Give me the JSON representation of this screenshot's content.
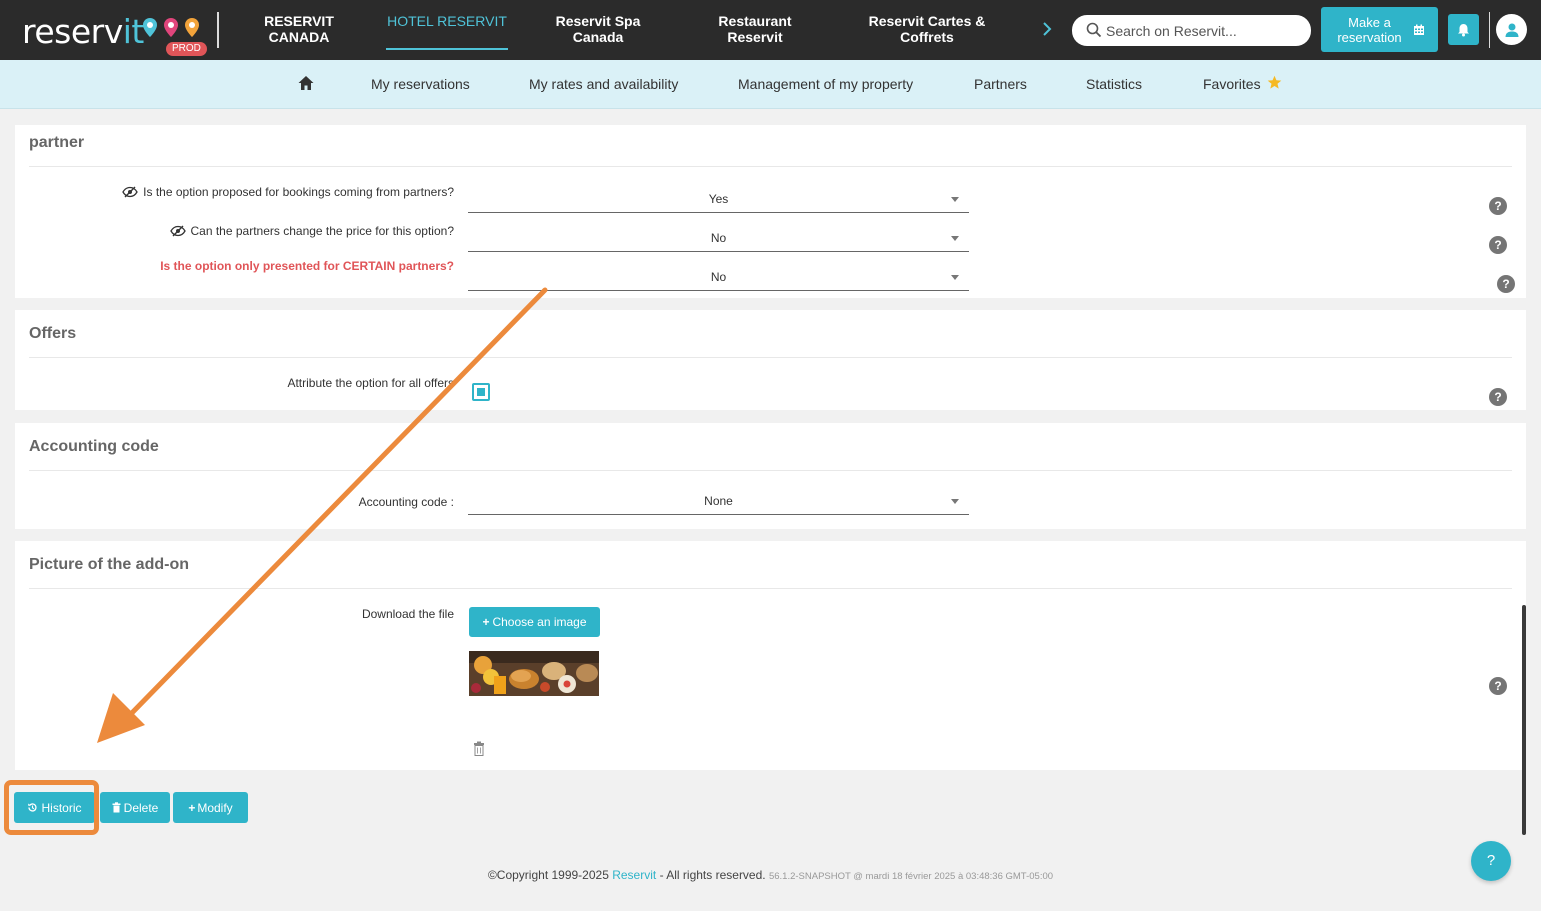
{
  "brand": {
    "logo_main": "reserv",
    "logo_accent": "it",
    "env_badge": "PROD"
  },
  "topnav": {
    "items": [
      {
        "label": "RESERVIT CANADA",
        "active": false
      },
      {
        "label": "HOTEL RESERVIT",
        "active": true
      },
      {
        "label": "Reservit Spa Canada",
        "active": false
      },
      {
        "label": "Restaurant Reservit",
        "active": false
      },
      {
        "label": "Reservit Cartes & Coffrets",
        "active": false
      }
    ],
    "more_icon": "chevron-right-icon",
    "search_placeholder": "Search on Reservit...",
    "make_reservation_label": "Make a reservation"
  },
  "subnav": {
    "home_icon": "home-icon",
    "items": [
      {
        "label": "My reservations"
      },
      {
        "label": "My rates and availability"
      },
      {
        "label": "Management of my property"
      },
      {
        "label": "Partners"
      },
      {
        "label": "Statistics"
      },
      {
        "label": "Favorites"
      }
    ]
  },
  "partner_section": {
    "title": "partner",
    "fields": [
      {
        "label": "Is the option proposed for bookings coming from partners?",
        "value": "Yes"
      },
      {
        "label": "Can the partners change the price for this option?",
        "value": "No"
      },
      {
        "label": "Is the option only presented for CERTAIN partners?",
        "value": "No"
      }
    ]
  },
  "offers_section": {
    "title": "Offers",
    "field_label": "Attribute the option for all offers",
    "checked": true
  },
  "accounting_section": {
    "title": "Accounting code",
    "field_label": "Accounting code :",
    "value": "None"
  },
  "picture_section": {
    "title": "Picture of the add-on",
    "field_label": "Download the file",
    "choose_button": "Choose an image"
  },
  "actions": {
    "historic": "Historic",
    "delete": "Delete",
    "modify": "Modify"
  },
  "footer": {
    "copyright": "©Copyright 1999-2025",
    "brand": "Reservit",
    "rights": "- All rights reserved.",
    "version": "56.1.2-SNAPSHOT @ mardi 18 février 2025 à 03:48:36 GMT-05:00"
  },
  "help_button": "?",
  "colors": {
    "accent": "#2fb4c9",
    "warning": "#e05558",
    "annotation": "#ec8a3c",
    "topbar": "#2b2b2b",
    "subnav": "#daf1f7"
  }
}
